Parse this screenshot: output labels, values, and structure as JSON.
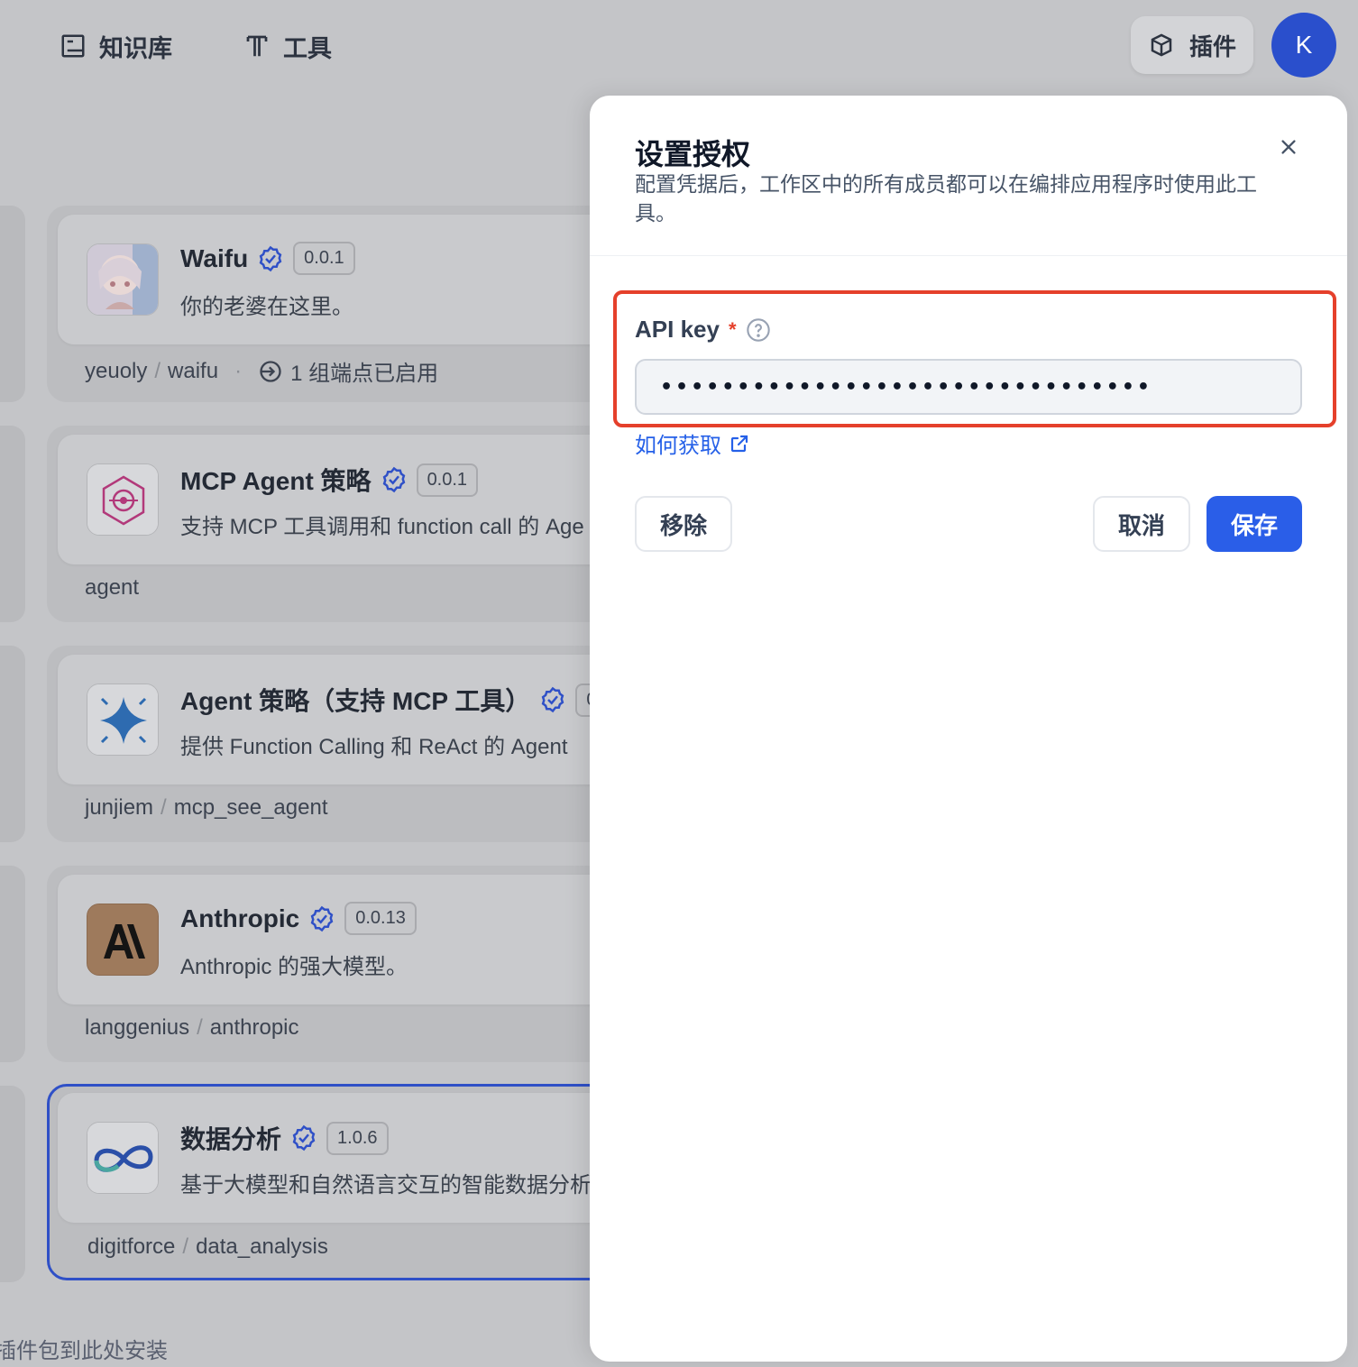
{
  "nav": {
    "knowledge": "知识库",
    "tools": "工具",
    "plugins": "插件",
    "avatar_initial": "K"
  },
  "cards": [
    {
      "title": "Waifu",
      "version": "0.0.1",
      "desc": "你的老婆在这里。",
      "author": "yeuoly",
      "repo": "waifu",
      "endpoints": "1 组端点已启用"
    },
    {
      "title": "MCP Agent 策略",
      "version": "0.0.1",
      "desc": "支持 MCP 工具调用和 function call 的 Age",
      "author": "agent"
    },
    {
      "title": "Agent 策略（支持 MCP 工具）",
      "version": "0",
      "desc": "提供 Function Calling 和 ReAct 的 Agent",
      "author": "junjiem",
      "repo": "mcp_see_agent"
    },
    {
      "title": "Anthropic",
      "version": "0.0.13",
      "desc": "Anthropic 的强大模型。",
      "author": "langgenius",
      "repo": "anthropic"
    },
    {
      "title": "数据分析",
      "version": "1.0.6",
      "desc": "基于大模型和自然语言交互的智能数据分析",
      "author": "digitforce",
      "repo": "data_analysis"
    }
  ],
  "drop_hint": "插件包到此处安装",
  "modal": {
    "title": "设置授权",
    "subtitle": "配置凭据后，工作区中的所有成员都可以在编排应用程序时使用此工具。",
    "field_label": "API key",
    "required_mark": "*",
    "api_key_value": "••••••••••••••••••••••••••••••••",
    "help_link": "如何获取",
    "remove": "移除",
    "cancel": "取消",
    "save": "保存"
  },
  "colors": {
    "primary": "#2a5ee8",
    "highlight_border": "#e5402b",
    "link": "#2560e8",
    "avatar_bg": "#2a4fcc",
    "selected_card_border": "#2f50c7"
  }
}
